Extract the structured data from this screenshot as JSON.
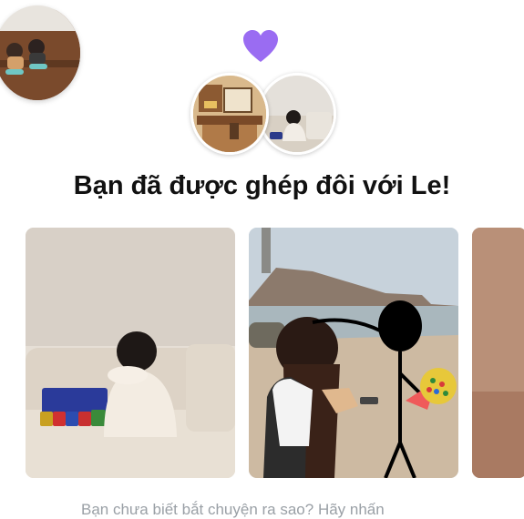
{
  "colors": {
    "heart": "#9a6cf2",
    "title_text": "#111111",
    "hint_text": "#9aa0a6",
    "background": "#ffffff"
  },
  "icons": {
    "heart": "purple-heart-icon"
  },
  "match": {
    "title": "Bạn đã được ghép đôi với Le!"
  },
  "footer": {
    "hint": "Bạn chưa biết bắt chuyện ra sao? Hãy nhấn"
  }
}
